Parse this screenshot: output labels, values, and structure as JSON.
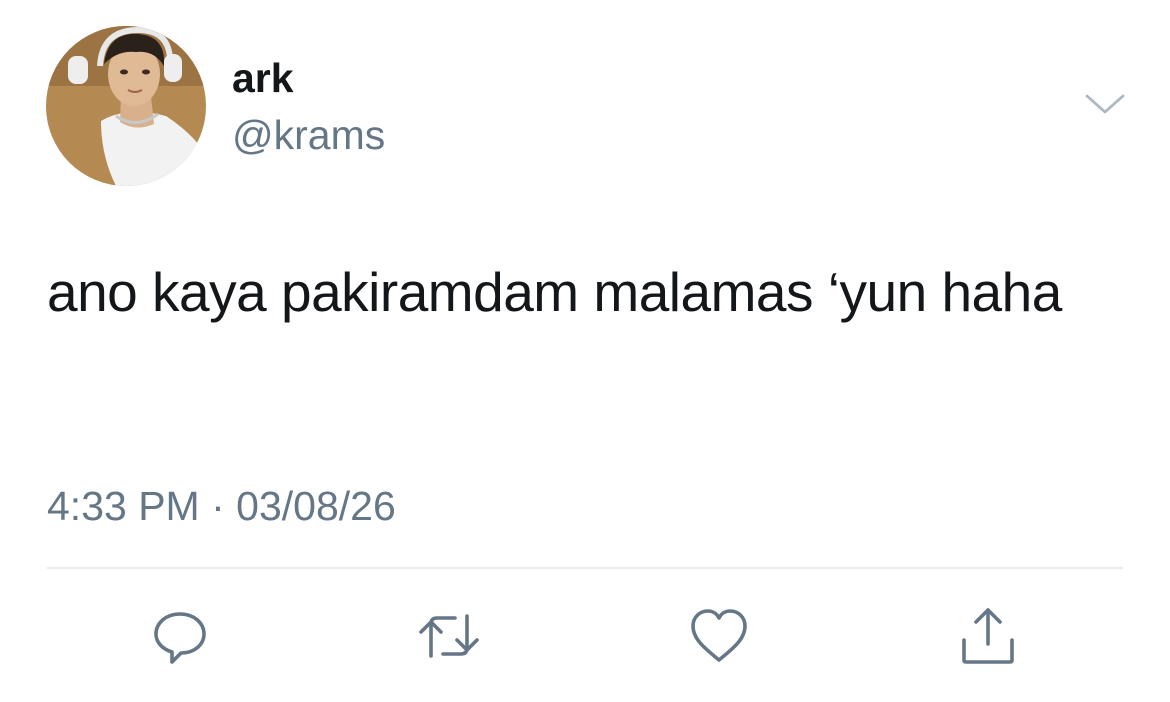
{
  "user": {
    "display_name": "ark",
    "handle": "@krams"
  },
  "tweet": {
    "text": "ano kaya pakiramdam malamas ‘yun haha",
    "time": "4:33 PM",
    "separator": "·",
    "date": "03/08/26"
  },
  "actions": [
    "reply",
    "retweet",
    "like",
    "share"
  ],
  "icons": {
    "more": "chevron-down-icon",
    "reply": "reply-icon",
    "retweet": "retweet-icon",
    "like": "heart-icon",
    "share": "share-icon"
  },
  "colors": {
    "text": "#14171a",
    "secondary": "#657786",
    "divider": "#e6ecf0",
    "icon": "#657786"
  }
}
